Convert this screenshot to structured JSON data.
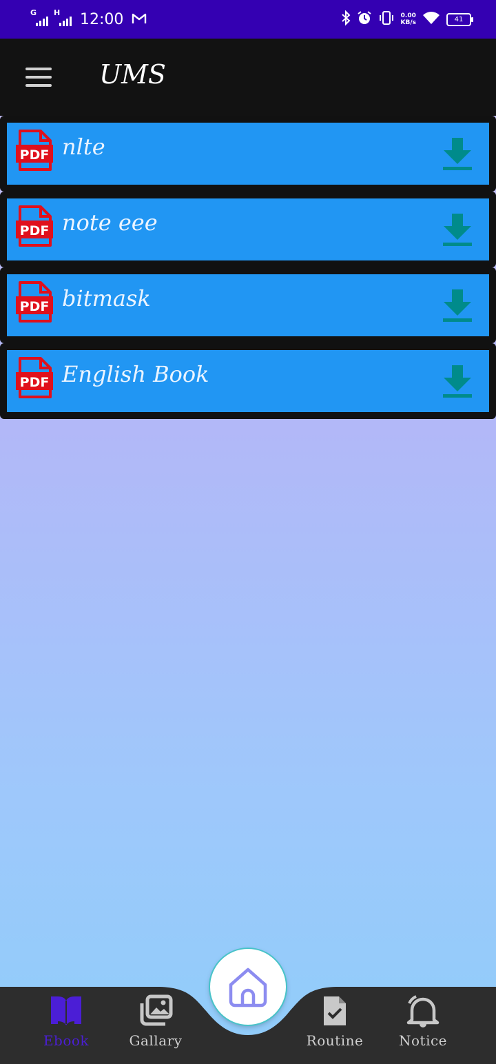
{
  "status_bar": {
    "signal_1_type": "G",
    "signal_2_type": "H",
    "time": "12:00",
    "notification_icon": "gmail-icon",
    "net_speed_value": "0.00",
    "net_speed_unit": "KB/s",
    "battery": "41"
  },
  "app_bar": {
    "title": "UMS"
  },
  "ebooks": [
    {
      "name": "nlte",
      "icon": "pdf-icon"
    },
    {
      "name": "note eee",
      "icon": "pdf-icon"
    },
    {
      "name": "bitmask",
      "icon": "pdf-icon"
    },
    {
      "name": "English Book",
      "icon": "pdf-icon"
    }
  ],
  "bottom_nav": {
    "items": [
      {
        "label": "Ebook",
        "icon": "book-icon",
        "active": true
      },
      {
        "label": "Gallary",
        "icon": "gallery-icon",
        "active": false
      },
      {
        "label": "Routine",
        "icon": "file-check-icon",
        "active": false
      },
      {
        "label": "Notice",
        "icon": "bell-icon",
        "active": false
      }
    ],
    "center_icon": "home-icon"
  },
  "colors": {
    "status_bar": "#3400b2",
    "app_bar": "#121212",
    "card": "#2196f3",
    "pdf_red": "#e0101c",
    "download_teal": "#008b8b",
    "active_nav": "#4b1ed6",
    "nav_bg": "#2d2d2d"
  }
}
